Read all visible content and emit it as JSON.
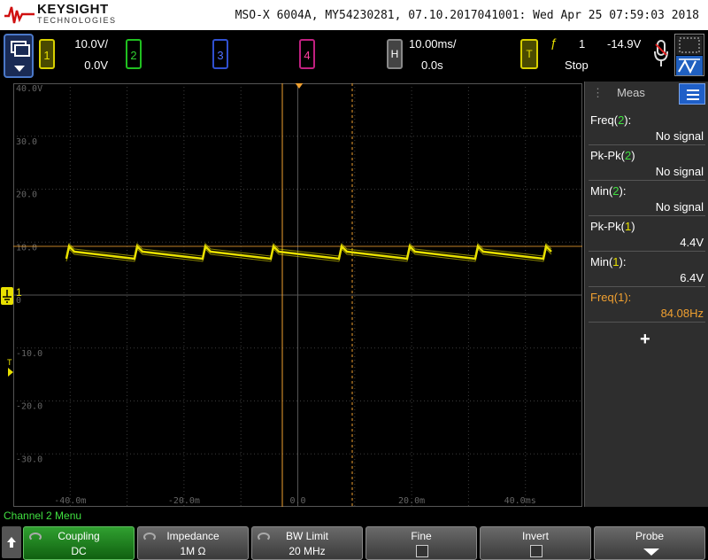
{
  "header": {
    "brand": "KEYSIGHT",
    "brand_sub": "TECHNOLOGIES",
    "instrument_info": "MSO-X 6004A, MY54230281, 07.10.2017041001: Wed Apr 25 07:59:03 2018"
  },
  "channels": {
    "ch1": {
      "label": "1",
      "scale": "10.0V/",
      "offset": "0.0V",
      "color": "#e8e000"
    },
    "ch2": {
      "label": "2",
      "color": "#30d030"
    },
    "ch3": {
      "label": "3",
      "color": "#5070ff"
    },
    "ch4": {
      "label": "4",
      "color": "#ff40a0"
    }
  },
  "horizontal": {
    "label": "H",
    "scale": "10.00ms/",
    "delay": "0.0s"
  },
  "trigger": {
    "label": "T",
    "edge_glyph": "ƒ",
    "source": "1",
    "level": "-14.9V",
    "status": "Stop"
  },
  "graticule": {
    "y_labels": [
      "40.0V",
      "30.0",
      "20.0",
      "10.0",
      "0",
      "-10.0",
      "-20.0",
      "-30.0"
    ],
    "x_labels": [
      "-40.0m",
      "-20.0m",
      "0.0",
      "20.0m",
      "40.0ms"
    ],
    "ch1_marker": "1",
    "trig_marker": "T"
  },
  "meas": {
    "tab_label": "Meas",
    "items": [
      {
        "name": "Freq(",
        "ch": "2",
        "close": "):",
        "value": "No signal"
      },
      {
        "name": "Pk-Pk(",
        "ch": "2",
        "close": ")",
        "value": "No signal"
      },
      {
        "name": "Min(",
        "ch": "2",
        "close": "):",
        "value": "No signal"
      },
      {
        "name": "Pk-Pk(",
        "ch": "1",
        "close": ")",
        "value": "4.4V"
      },
      {
        "name": "Min(",
        "ch": "1",
        "close": "):",
        "value": "6.4V"
      },
      {
        "name": "Freq(",
        "ch": "1",
        "close": "):",
        "value": "84.08Hz"
      }
    ],
    "add_glyph": "+"
  },
  "menu_title": "Channel 2 Menu",
  "softkeys": [
    {
      "label": "Coupling",
      "value": "DC"
    },
    {
      "label": "Impedance",
      "value": "1M Ω"
    },
    {
      "label": "BW Limit",
      "value": "20 MHz"
    },
    {
      "label": "Fine",
      "value": ""
    },
    {
      "label": "Invert",
      "value": ""
    },
    {
      "label": "Probe",
      "value": ""
    }
  ]
}
